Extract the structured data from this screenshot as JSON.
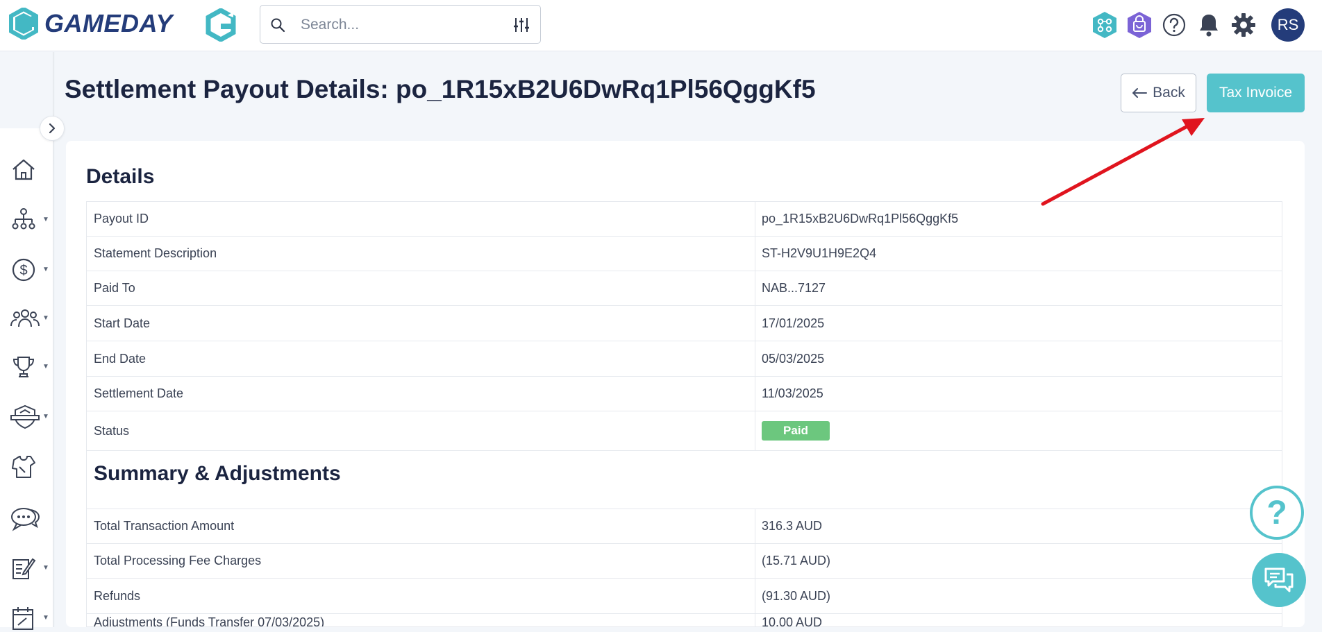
{
  "brand": {
    "name": "GAMEDAY",
    "color": "#243c7a",
    "accent": "#55c3cc"
  },
  "search": {
    "placeholder": "Search..."
  },
  "header_icons": [
    "apps-network-icon",
    "shopping-bag-icon",
    "help-icon",
    "bell-icon",
    "gear-icon"
  ],
  "user": {
    "initials": "RS"
  },
  "sidebar": {
    "items": [
      {
        "icon": "home-icon"
      },
      {
        "icon": "org-structure-icon"
      },
      {
        "icon": "dollar-icon"
      },
      {
        "icon": "people-icon"
      },
      {
        "icon": "trophy-icon"
      },
      {
        "icon": "shield-badge-icon"
      },
      {
        "icon": "jersey-icon"
      },
      {
        "icon": "chat-bubbles-icon"
      },
      {
        "icon": "edit-doc-icon"
      },
      {
        "icon": "calendar-icon"
      }
    ]
  },
  "page": {
    "title": "Settlement Payout Details: po_1R15xB2U6DwRq1Pl56QggKf5",
    "back_label": "Back",
    "tax_invoice_label": "Tax Invoice"
  },
  "details": {
    "heading": "Details",
    "rows": [
      {
        "label": "Payout ID",
        "value": "po_1R15xB2U6DwRq1Pl56QggKf5"
      },
      {
        "label": "Statement Description",
        "value": "ST-H2V9U1H9E2Q4"
      },
      {
        "label": "Paid To",
        "value": "NAB...7127"
      },
      {
        "label": "Start Date",
        "value": "17/01/2025"
      },
      {
        "label": "End Date",
        "value": "05/03/2025"
      },
      {
        "label": "Settlement Date",
        "value": "11/03/2025"
      },
      {
        "label": "Status",
        "value": "Paid"
      }
    ]
  },
  "summary": {
    "heading": "Summary & Adjustments",
    "rows": [
      {
        "label": "Total Transaction Amount",
        "value": "316.3 AUD"
      },
      {
        "label": "Total Processing Fee Charges",
        "value": "(15.71 AUD)"
      },
      {
        "label": "Refunds",
        "value": "(91.30 AUD)"
      },
      {
        "label": "Adjustments (Funds Transfer 07/03/2025)",
        "value": "10.00 AUD"
      }
    ]
  },
  "colors": {
    "status_paid": "#6cc77e",
    "annotation_arrow": "#e0141e"
  }
}
